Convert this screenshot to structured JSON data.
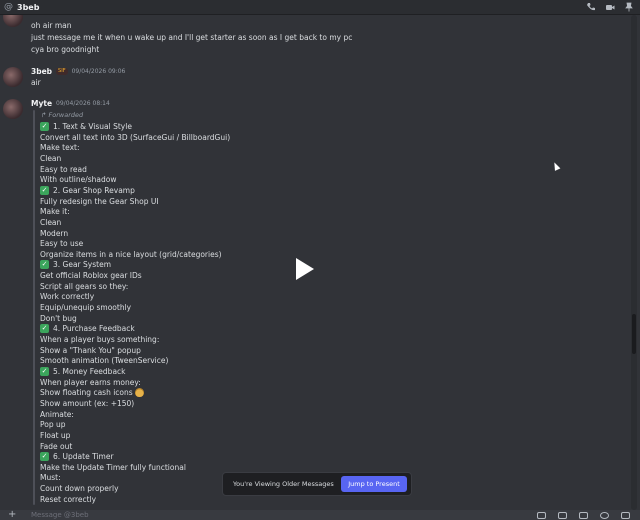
{
  "header": {
    "at_symbol": "@",
    "channel_name": "3beb",
    "icons": [
      "phone-icon",
      "video-icon",
      "pin-icon"
    ]
  },
  "messages": {
    "prev_lines": [
      "oh air man",
      "just message me it when u wake up and I'll get starter as soon as I get back to my pc",
      "cya bro goodnight"
    ],
    "msg2": {
      "author": "3beb",
      "badge": "SIF",
      "timestamp": "09/04/2026 09:06",
      "text": "air"
    },
    "msg3": {
      "author": "Myte",
      "timestamp": "09/04/2026 08:14",
      "forwarded_label": "Forwarded",
      "lines": [
        {
          "check": true,
          "text": "1. Text & Visual Style"
        },
        {
          "check": false,
          "text": "Convert all text into 3D (SurfaceGui / BillboardGui)"
        },
        {
          "check": false,
          "text": "Make text:"
        },
        {
          "check": false,
          "text": "Clean"
        },
        {
          "check": false,
          "text": "Easy to read"
        },
        {
          "check": false,
          "text": "With outline/shadow"
        },
        {
          "check": true,
          "text": "2. Gear Shop Revamp"
        },
        {
          "check": false,
          "text": "Fully redesign the Gear Shop UI"
        },
        {
          "check": false,
          "text": "Make it:"
        },
        {
          "check": false,
          "text": "Clean"
        },
        {
          "check": false,
          "text": "Modern"
        },
        {
          "check": false,
          "text": "Easy to use"
        },
        {
          "check": false,
          "text": "Organize items in a nice layout (grid/categories)"
        },
        {
          "check": true,
          "text": "3. Gear System"
        },
        {
          "check": false,
          "text": "Get official Roblox gear IDs"
        },
        {
          "check": false,
          "text": "Script all gears so they:"
        },
        {
          "check": false,
          "text": "Work correctly"
        },
        {
          "check": false,
          "text": "Equip/unequip smoothly"
        },
        {
          "check": false,
          "text": "Don't bug"
        },
        {
          "check": true,
          "text": "4. Purchase Feedback"
        },
        {
          "check": false,
          "text": "When a player buys something:"
        },
        {
          "check": false,
          "text": "Show a \"Thank You\" popup"
        },
        {
          "check": false,
          "text": "Smooth animation (TweenService)"
        },
        {
          "check": true,
          "text": "5. Money Feedback"
        },
        {
          "check": false,
          "text": "When player earns money:"
        },
        {
          "check": false,
          "text": "Show floating cash icons",
          "money": true
        },
        {
          "check": false,
          "text": "Show amount (ex: +150)"
        },
        {
          "check": false,
          "text": "Animate:"
        },
        {
          "check": false,
          "text": "Pop up"
        },
        {
          "check": false,
          "text": "Float up"
        },
        {
          "check": false,
          "text": "Fade out"
        },
        {
          "check": true,
          "text": "6. Update Timer"
        },
        {
          "check": false,
          "text": "Make the Update Timer fully functional"
        },
        {
          "check": false,
          "text": "Must:"
        },
        {
          "check": false,
          "text": "Count down properly"
        },
        {
          "check": false,
          "text": "Reset correctly"
        }
      ]
    }
  },
  "banner": {
    "text": "You're Viewing Older Messages",
    "jump_label": "Jump to Present"
  },
  "composer": {
    "placeholder": "Message @3beb",
    "icons": [
      "gift-icon",
      "gif-icon",
      "sticker-icon",
      "emoji-icon",
      "apps-icon"
    ]
  },
  "colors": {
    "background": "#313338",
    "accent": "#5865f2",
    "check_green": "#3ba55c"
  }
}
